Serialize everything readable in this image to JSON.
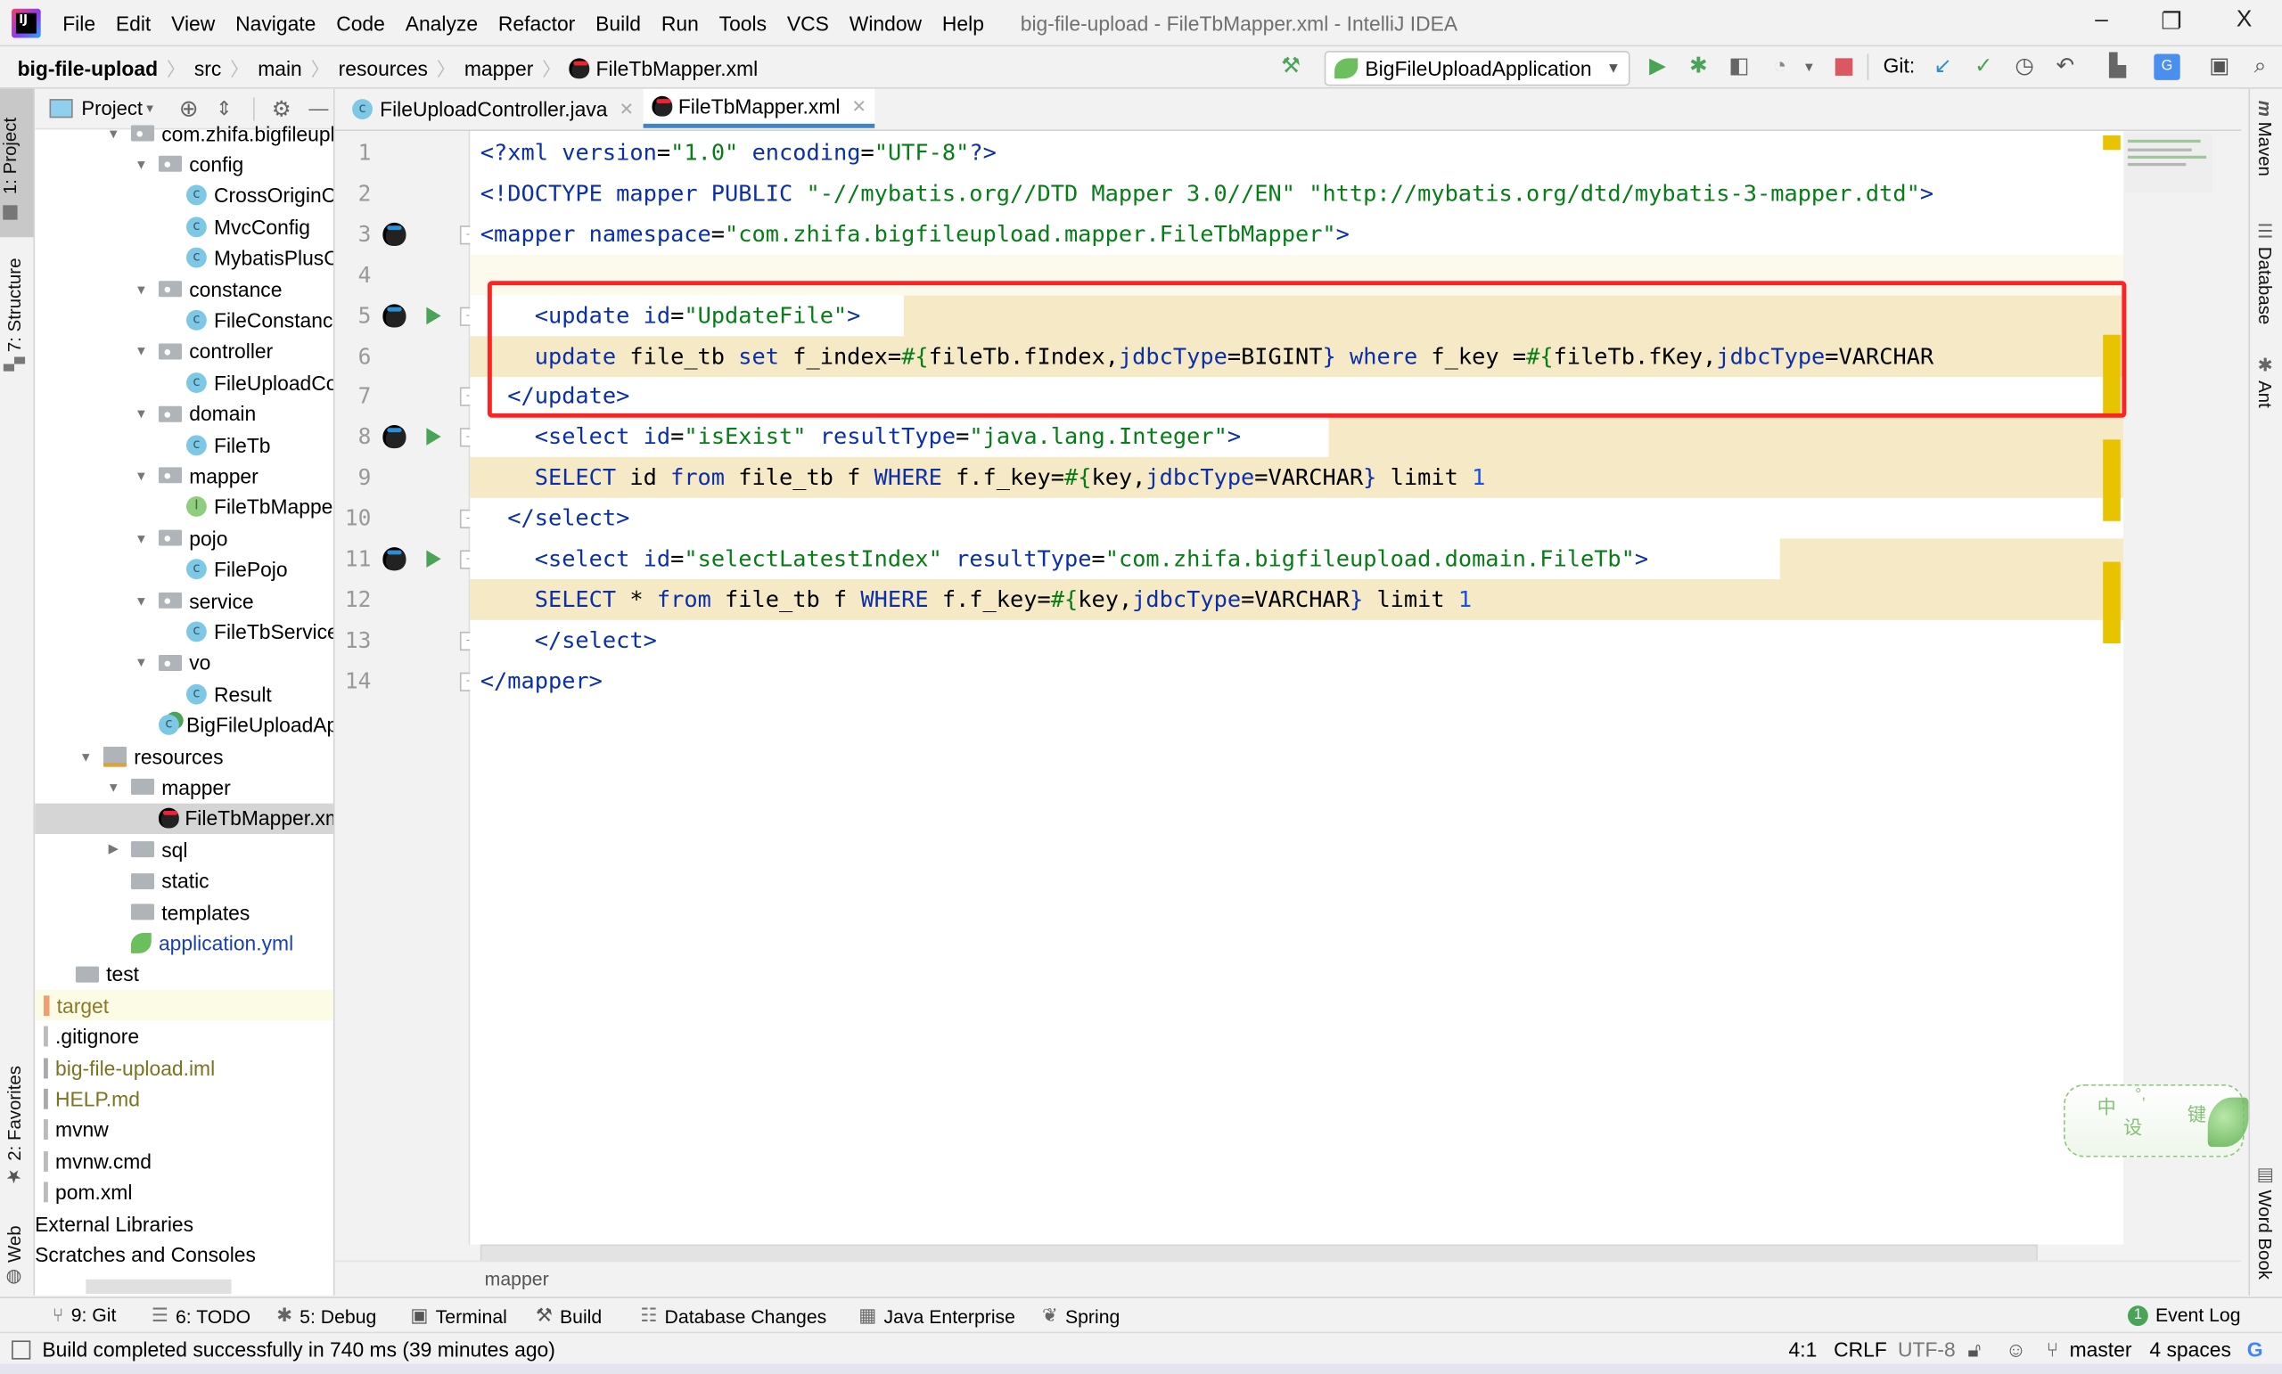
{
  "window": {
    "title": "big-file-upload - FileTbMapper.xml - IntelliJ IDEA",
    "controls": {
      "minimize": "–",
      "restore": "❐",
      "close": "X"
    }
  },
  "menu": [
    "File",
    "Edit",
    "View",
    "Navigate",
    "Code",
    "Analyze",
    "Refactor",
    "Build",
    "Run",
    "Tools",
    "VCS",
    "Window",
    "Help"
  ],
  "breadcrumb": [
    "big-file-upload",
    "src",
    "main",
    "resources",
    "mapper",
    "FileTbMapper.xml"
  ],
  "toolbar": {
    "run_config": "BigFileUploadApplication",
    "git_label": "Git:",
    "icons": [
      "build-hammer-icon",
      "run-icon",
      "debug-icon",
      "coverage-icon",
      "profile-icon",
      "stop-icon",
      "git-update-icon",
      "git-commit-icon",
      "git-history-icon",
      "git-rollback-icon",
      "project-structure-icon",
      "translate-icon",
      "presentation-icon",
      "search-icon"
    ]
  },
  "left_stripe": {
    "project": "1: Project",
    "structure": "7: Structure",
    "favorites": "2: Favorites",
    "web": "Web"
  },
  "right_stripe": {
    "maven": "Maven",
    "database": "Database",
    "ant": "Ant",
    "wordbook": "Word Book"
  },
  "project_pane": {
    "title": "Project",
    "tree": [
      {
        "label": "com.zhifa.bigfileupload",
        "kind": "package",
        "depth": 2,
        "expanded": true
      },
      {
        "label": "config",
        "kind": "package",
        "depth": 3,
        "expanded": true
      },
      {
        "label": "CrossOriginConfig",
        "kind": "class",
        "depth": 4
      },
      {
        "label": "MvcConfig",
        "kind": "class",
        "depth": 4
      },
      {
        "label": "MybatisPlusConfig",
        "kind": "class",
        "depth": 4
      },
      {
        "label": "constance",
        "kind": "package",
        "depth": 3,
        "expanded": true
      },
      {
        "label": "FileConstance",
        "kind": "class",
        "depth": 4
      },
      {
        "label": "controller",
        "kind": "package",
        "depth": 3,
        "expanded": true
      },
      {
        "label": "FileUploadController",
        "kind": "class",
        "depth": 4
      },
      {
        "label": "domain",
        "kind": "package",
        "depth": 3,
        "expanded": true
      },
      {
        "label": "FileTb",
        "kind": "class",
        "depth": 4
      },
      {
        "label": "mapper",
        "kind": "package",
        "depth": 3,
        "expanded": true
      },
      {
        "label": "FileTbMapper",
        "kind": "interface",
        "depth": 4
      },
      {
        "label": "pojo",
        "kind": "package",
        "depth": 3,
        "expanded": true
      },
      {
        "label": "FilePojo",
        "kind": "class",
        "depth": 4
      },
      {
        "label": "service",
        "kind": "package",
        "depth": 3,
        "expanded": true
      },
      {
        "label": "FileTbService",
        "kind": "class",
        "depth": 4
      },
      {
        "label": "vo",
        "kind": "package",
        "depth": 3,
        "expanded": true
      },
      {
        "label": "Result",
        "kind": "class",
        "depth": 4
      },
      {
        "label": "BigFileUploadApplication",
        "kind": "spring-class",
        "depth": 3
      },
      {
        "label": "resources",
        "kind": "resources",
        "depth": 1,
        "expanded": true
      },
      {
        "label": "mapper",
        "kind": "folder",
        "depth": 2,
        "expanded": true
      },
      {
        "label": "FileTbMapper.xml",
        "kind": "mybatis-xml",
        "depth": 3,
        "selected": true
      },
      {
        "label": "sql",
        "kind": "folder",
        "depth": 2,
        "expanded": false
      },
      {
        "label": "static",
        "kind": "folder",
        "depth": 2
      },
      {
        "label": "templates",
        "kind": "folder",
        "depth": 2
      },
      {
        "label": "application.yml",
        "kind": "spring-yml",
        "depth": 2
      },
      {
        "label": "test",
        "kind": "folder",
        "depth": 0
      },
      {
        "label": "target",
        "kind": "excluded",
        "depth": -1
      },
      {
        "label": ".gitignore",
        "kind": "file",
        "depth": -1
      },
      {
        "label": "big-file-upload.iml",
        "kind": "file-olive",
        "depth": -1
      },
      {
        "label": "HELP.md",
        "kind": "file-olive",
        "depth": -1
      },
      {
        "label": "mvnw",
        "kind": "file",
        "depth": -1
      },
      {
        "label": "mvnw.cmd",
        "kind": "file",
        "depth": -1
      },
      {
        "label": "pom.xml",
        "kind": "file",
        "depth": -1
      },
      {
        "label": "External Libraries",
        "kind": "root",
        "depth": -2
      },
      {
        "label": "Scratches and Consoles",
        "kind": "root",
        "depth": -2
      }
    ]
  },
  "editor": {
    "tabs": [
      {
        "label": "FileUploadController.java",
        "active": false
      },
      {
        "label": "FileTbMapper.xml",
        "active": true
      }
    ],
    "lines": [
      {
        "n": "1",
        "tokens": [
          [
            "tag",
            "<?"
          ],
          [
            "tag",
            "xml "
          ],
          [
            "attr",
            "version"
          ],
          [
            "plain",
            "="
          ],
          [
            "str",
            "\"1.0\""
          ],
          [
            "plain",
            " "
          ],
          [
            "attr",
            "encoding"
          ],
          [
            "plain",
            "="
          ],
          [
            "str",
            "\"UTF-8\""
          ],
          [
            "tag",
            "?>"
          ]
        ]
      },
      {
        "n": "2",
        "tokens": [
          [
            "tag",
            "<!DOCTYPE "
          ],
          [
            "attr",
            "mapper "
          ],
          [
            "attr",
            "PUBLIC "
          ],
          [
            "str",
            "\"-//mybatis.org//DTD Mapper 3.0//EN\""
          ],
          [
            "plain",
            " "
          ],
          [
            "str",
            "\"http://mybatis.org/dtd/mybatis-3-mapper.dtd\""
          ],
          [
            "tag",
            ">"
          ]
        ]
      },
      {
        "n": "3",
        "tokens": [
          [
            "tag",
            "<mapper "
          ],
          [
            "attr",
            "namespace"
          ],
          [
            "plain",
            "="
          ],
          [
            "str",
            "\"com.zhifa.bigfileupload.mapper.FileTbMapper\""
          ],
          [
            "tag",
            ">"
          ]
        ]
      },
      {
        "n": "4",
        "tokens": []
      },
      {
        "n": "5",
        "tokens": [
          [
            "plain",
            "    "
          ],
          [
            "tag",
            "<update "
          ],
          [
            "attr",
            "id"
          ],
          [
            "plain",
            "="
          ],
          [
            "str",
            "\"UpdateFile\""
          ],
          [
            "tag",
            ">"
          ]
        ]
      },
      {
        "n": "6",
        "tokens": [
          [
            "plain",
            "    "
          ],
          [
            "kw",
            "update"
          ],
          [
            "plain",
            " file_tb "
          ],
          [
            "kw",
            "set"
          ],
          [
            "plain",
            " f_index="
          ],
          [
            "str",
            "#{"
          ],
          [
            "plain",
            "fileTb.fIndex,"
          ],
          [
            "kw",
            "jdbcType"
          ],
          [
            "plain",
            "=BIGINT"
          ],
          [
            "kw",
            "}"
          ],
          [
            "plain",
            " "
          ],
          [
            "kw",
            "where"
          ],
          [
            "plain",
            " f_key ="
          ],
          [
            "str",
            "#{"
          ],
          [
            "plain",
            "fileTb.fKey,"
          ],
          [
            "kw",
            "jdbcType"
          ],
          [
            "plain",
            "=VARCHAR"
          ]
        ]
      },
      {
        "n": "7",
        "tokens": [
          [
            "plain",
            "  "
          ],
          [
            "tag",
            "</update>"
          ]
        ]
      },
      {
        "n": "8",
        "tokens": [
          [
            "plain",
            "    "
          ],
          [
            "tag",
            "<select "
          ],
          [
            "attr",
            "id"
          ],
          [
            "plain",
            "="
          ],
          [
            "str",
            "\"isExist\""
          ],
          [
            "plain",
            " "
          ],
          [
            "attr",
            "resultType"
          ],
          [
            "plain",
            "="
          ],
          [
            "str",
            "\"java.lang.Integer\""
          ],
          [
            "tag",
            ">"
          ]
        ]
      },
      {
        "n": "9",
        "tokens": [
          [
            "plain",
            "    "
          ],
          [
            "kw",
            "SELECT"
          ],
          [
            "plain",
            " id "
          ],
          [
            "kw",
            "from"
          ],
          [
            "plain",
            " file_tb f "
          ],
          [
            "kw",
            "WHERE"
          ],
          [
            "plain",
            " f.f_key="
          ],
          [
            "str",
            "#{"
          ],
          [
            "plain",
            "key,"
          ],
          [
            "kw",
            "jdbcType"
          ],
          [
            "plain",
            "=VARCHAR"
          ],
          [
            "kw",
            "}"
          ],
          [
            "plain",
            " limit "
          ],
          [
            "num",
            "1"
          ]
        ]
      },
      {
        "n": "10",
        "tokens": [
          [
            "plain",
            "  "
          ],
          [
            "tag",
            "</select>"
          ]
        ]
      },
      {
        "n": "11",
        "tokens": [
          [
            "plain",
            "    "
          ],
          [
            "tag",
            "<select "
          ],
          [
            "attr",
            "id"
          ],
          [
            "plain",
            "="
          ],
          [
            "str",
            "\"selectLatestIndex\""
          ],
          [
            "plain",
            " "
          ],
          [
            "attr",
            "resultType"
          ],
          [
            "plain",
            "="
          ],
          [
            "str",
            "\"com.zhifa.bigfileupload.domain.FileTb\""
          ],
          [
            "tag",
            ">"
          ]
        ]
      },
      {
        "n": "12",
        "tokens": [
          [
            "plain",
            "    "
          ],
          [
            "kw",
            "SELECT"
          ],
          [
            "plain",
            " * "
          ],
          [
            "kw",
            "from"
          ],
          [
            "plain",
            " file_tb f "
          ],
          [
            "kw",
            "WHERE"
          ],
          [
            "plain",
            " f.f_key="
          ],
          [
            "str",
            "#{"
          ],
          [
            "plain",
            "key,"
          ],
          [
            "kw",
            "jdbcType"
          ],
          [
            "plain",
            "=VARCHAR"
          ],
          [
            "kw",
            "}"
          ],
          [
            "plain",
            " limit "
          ],
          [
            "num",
            "1"
          ]
        ]
      },
      {
        "n": "13",
        "tokens": [
          [
            "plain",
            "    "
          ],
          [
            "tag",
            "</select>"
          ]
        ]
      },
      {
        "n": "14",
        "tokens": [
          [
            "tag",
            "</mapper>"
          ]
        ]
      }
    ],
    "footer_breadcrumb": "mapper"
  },
  "ime_widget": {
    "chars": [
      "中",
      "°,",
      "设",
      "键"
    ]
  },
  "bottom_tools": [
    {
      "key": "9",
      "label": "9: Git",
      "icon": "git-branch-icon"
    },
    {
      "key": "6",
      "label": "6: TODO",
      "icon": "todo-list-icon"
    },
    {
      "key": "5",
      "label": "5: Debug",
      "icon": "debug-icon"
    },
    {
      "key": "",
      "label": "Terminal",
      "icon": "terminal-icon"
    },
    {
      "key": "",
      "label": "Build",
      "icon": "build-hammer-icon"
    },
    {
      "key": "",
      "label": "Database Changes",
      "icon": "database-changes-icon"
    },
    {
      "key": "",
      "label": "Java Enterprise",
      "icon": "java-enterprise-icon"
    },
    {
      "key": "",
      "label": "Spring",
      "icon": "spring-leaf-icon"
    }
  ],
  "event_log": {
    "label": "Event Log",
    "count": "1"
  },
  "status": {
    "message": "Build completed successfully in 740 ms (39 minutes ago)",
    "position": "4:1",
    "line_sep": "CRLF",
    "encoding": "UTF-8",
    "branch": "master",
    "indent": "4 spaces"
  },
  "colors": {
    "accent": "#4083c9",
    "highlight_box": "#ff2222",
    "injection_bg": "#f5e9c6",
    "warning_mark": "#e8c300"
  }
}
